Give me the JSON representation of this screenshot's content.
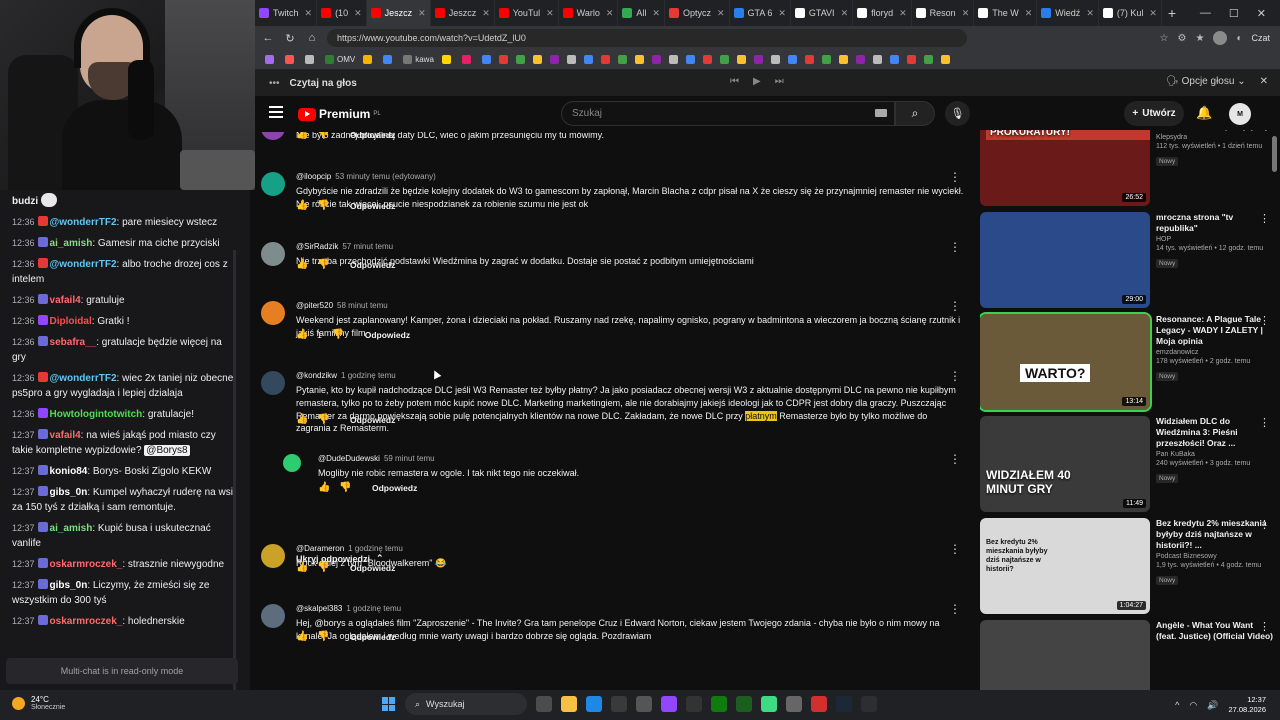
{
  "chat": {
    "top_username": "budzi",
    "messages": [
      {
        "time": "12:36",
        "badge": "yt",
        "user": "@wonderrTF2",
        "color": "#5ec7f5",
        "text": "pare miesiecy wstecz"
      },
      {
        "time": "12:36",
        "badge": "sub",
        "user": "ai_amish",
        "color": "#7ee07e",
        "text": "Gamesir ma ciche przyciski"
      },
      {
        "time": "12:36",
        "badge": "yt",
        "user": "@wonderrTF2",
        "color": "#5ec7f5",
        "text": "albo troche drozej cos z intelem"
      },
      {
        "time": "12:36",
        "badge": "sub",
        "user": "vafail4",
        "color": "#ff6b6b",
        "text": "gratuluje"
      },
      {
        "time": "12:36",
        "badge": "tw",
        "user": "Diploidal",
        "color": "#ff4d4d",
        "text": "Gratki !"
      },
      {
        "time": "12:36",
        "badge": "sub",
        "user": "sebafra__",
        "color": "#ff6b6b",
        "text": "gratulacje będzie więcej na gry"
      },
      {
        "time": "12:36",
        "badge": "yt",
        "user": "@wonderrTF2",
        "color": "#5ec7f5",
        "text": "wiec 2x taniej niz obecne ps5pro a gry wygladaja i lepiej dzialaja"
      },
      {
        "time": "12:36",
        "badge": "tw",
        "user": "Howtologintotwitch",
        "color": "#4cde4c",
        "text": "gratulacje!"
      },
      {
        "time": "12:37",
        "badge": "sub",
        "user": "vafail4",
        "color": "#ff6b6b",
        "text": "na wieś jakąś pod miasto czy takie kompletne wypizdowie?",
        "mention": "@Borys8"
      },
      {
        "time": "12:37",
        "badge": "sub",
        "user": "konio84",
        "color": "#ffffff",
        "text": "Borys- Boski Zigolo KEKW"
      },
      {
        "time": "12:37",
        "badge": "sub",
        "user": "gibs_0n",
        "color": "#ffffff",
        "text": "Kumpel wyhaczył ruderę na wsi za 150 tyś z działką i sam remontuje."
      },
      {
        "time": "12:37",
        "badge": "sub",
        "user": "ai_amish",
        "color": "#7ee07e",
        "text": "Kupić busa i uskutecznać vanlife"
      },
      {
        "time": "12:37",
        "badge": "sub",
        "user": "oskarmroczek_",
        "color": "#ff6b6b",
        "text": "strasznie niewygodne"
      },
      {
        "time": "12:37",
        "badge": "sub",
        "user": "gibs_0n",
        "color": "#ffffff",
        "text": "Liczymy, że zmieści się ze wszystkim do 300 tyś"
      },
      {
        "time": "12:37",
        "badge": "sub",
        "user": "oskarmroczek_",
        "color": "#ff6b6b",
        "text": "holednerskie"
      }
    ],
    "readonly_notice": "Multi-chat is in read-only mode"
  },
  "browser": {
    "tabs": [
      {
        "label": "Twitch",
        "color": "#9147ff"
      },
      {
        "label": "(10",
        "color": "#ff0000"
      },
      {
        "label": "Jeszcz",
        "color": "#ff0000",
        "active": true
      },
      {
        "label": "Jeszcz",
        "color": "#ff0000"
      },
      {
        "label": "YouTul",
        "color": "#ff0000"
      },
      {
        "label": "Warlo",
        "color": "#ff0000"
      },
      {
        "label": "All",
        "color": "#34a853"
      },
      {
        "label": "Optycz",
        "color": "#e53935"
      },
      {
        "label": "GTA 6",
        "color": "#2b7de9"
      },
      {
        "label": "GTAVI",
        "color": "#ffffff"
      },
      {
        "label": "floryd",
        "color": "#ffffff"
      },
      {
        "label": "Reson",
        "color": "#ffffff"
      },
      {
        "label": "The W",
        "color": "#ffffff"
      },
      {
        "label": "Wiedź",
        "color": "#2b7de9"
      },
      {
        "label": "(7) Kul",
        "color": "#ffffff"
      }
    ],
    "url": "https://www.youtube.com/watch?v=UdetdZ_lU0",
    "czat_label": "Czat",
    "bookmarks": [
      {
        "label": "",
        "color": "#a36cf0"
      },
      {
        "label": "",
        "color": "#ff5252"
      },
      {
        "label": "",
        "color": "#bbbbbb"
      },
      {
        "label": "OMV",
        "color": "#2e7d32"
      },
      {
        "label": "",
        "color": "#f4b400"
      },
      {
        "label": "",
        "color": "#4285f4"
      },
      {
        "label": "kawa",
        "color": "#777777"
      },
      {
        "label": "",
        "color": "#ffd600"
      },
      {
        "label": "",
        "color": "#e91e63"
      }
    ],
    "read_aloud": {
      "title": "Czytaj na głos",
      "voice_options": "Opcje głosu"
    }
  },
  "youtube": {
    "brand": "Premium",
    "brand_sup": "PL",
    "search_placeholder": "Szukaj",
    "create_label": "Utwórz",
    "reply_label": "Odpowiedz",
    "hide_replies_label": "Ukryj odpowiedzi",
    "comments": [
      {
        "author": "@jazon9",
        "time": "26 minut temu",
        "avatar": "#8e44ad",
        "text": "Nie było żadnej oficjalnej daty DLC, wiec o jakim przesunięciu my tu mówimy.",
        "likes": ""
      },
      {
        "author": "@iloopcip",
        "time": "53 minuty temu (edytowany)",
        "avatar": "#16a085",
        "text": "Gdybyście nie zdradzili że będzie kolejny dodatek do W3 to gamescom by zapłonął, Marcin Blacha z cdpr pisał na X że cieszy się że przynajmniej remaster nie wyciekł. Nie róbcie tak więcej, psucie niespodzianek za robienie szumu nie jest ok",
        "likes": ""
      },
      {
        "author": "@SirRadzik",
        "time": "57 minut temu",
        "avatar": "#7f8c8d",
        "text": "Nie trzeba przechodzić podstawki Wiedźmina by zagrać w dodatku. Dostaje sie postać z podbitym umiejętnościami",
        "likes": ""
      },
      {
        "author": "@piter520",
        "time": "58 minut temu",
        "avatar": "#e67e22",
        "text": "Weekend jest zaplanowany! Kamper, żona i dzieciaki na pokład. Ruszamy nad rzekę, napalimy ognisko, pograny w badmintona a wieczorem ja boczną ścianę rzutnik i jakiś familijny film",
        "likes": "1"
      },
      {
        "author": "@kondzikw",
        "time": "1 godzinę temu",
        "avatar": "#34495e",
        "text_before": "Pytanie, kto by kupił nadchodzące DLC jeśli W3 Remaster też byłby płatny? Ja jako posiadacz obecnej wersji W3 z aktualnie dostępnymi DLC na pewno nie kupiłbym remastera, tylko po to żeby potem móc kupić nowe DLC. Marketing marketingiem, ale nie dorabiajmy jakiejś ideologi jak to CDPR jest dobry dla graczy. Puszczając Remaster za darmo powiększają sobie pulę potencjalnych klientów na nowe DLC. Zakładam, że nowe DLC przy ",
        "highlight": "płatnym",
        "text_after": " Remasterze było by tylko możliwe do zagrania z Remasterm.",
        "likes": ""
      },
      {
        "author": "@DudeDudewski",
        "time": "59 minut temu",
        "avatar": "#2ecc71",
        "text": "Mogliby nie robic remastera w ogole. I tak nikt tego nie oczekiwał.",
        "likes": ""
      },
      {
        "author": "@Darameron",
        "time": "1 godzinę temu",
        "avatar": "#c9a227",
        "text": "Rock dalej z tym \"Bloodwalkerem\" 😂",
        "likes": ""
      },
      {
        "author": "@skalpel383",
        "time": "1 godzinę temu",
        "avatar": "#5d6d7e",
        "text": "Hej, @borys a oglądałeś film \"Zaproszenie\" - The Invite? Gra tam penelope Cruz i Edward Norton, ciekaw jestem Twojego zdania - chyba nie było o nim mowy na kanale. Ja oglądałem i według mnie warty uwagi i bardzo dobrze się ogląda. Pozdrawiam",
        "likes": ""
      }
    ],
    "sidebar": [
      {
        "title": "Ta Pisarka Pozywa KAŻDEGO Kto Ją Skrytykuje",
        "channel": "Klepsydra",
        "views": "112 tys.",
        "age": "1 dzień temu",
        "badge": "Nowy",
        "duration": "26:52",
        "caption": "PISMO TRAFIA DO PROKURATURY!",
        "bg": "#6b1a1a"
      },
      {
        "title": "mroczna strona \"tv republika\"",
        "channel": "HOP",
        "views": "14 tys.",
        "age": "12 godz. temu",
        "badge": "Nowy",
        "duration": "29:00",
        "caption": "",
        "bg": "#2b4a8a"
      },
      {
        "title": "Resonance: A Plague Tale Legacy - WADY I ZALETY | Moja opinia",
        "channel": "emzdanowicz",
        "views": "178",
        "age": "2 godz. temu",
        "badge": "Nowy",
        "duration": "13:14",
        "caption": "WARTO?",
        "bg": "#6a5a3a"
      },
      {
        "title": "Widziałem DLC do Wiedźmina 3: Pieśni przeszłości! Oraz ...",
        "channel": "Pan KuBaka",
        "views": "240",
        "age": "3 godz. temu",
        "badge": "Nowy",
        "duration": "11:49",
        "caption": "WIDZIAŁEM 40 MINUT GRY",
        "bg": "#3a3a3a"
      },
      {
        "title": "Bez kredytu 2% mieszkania byłyby dziś najtańsze w historii?! ...",
        "channel": "Podcast Biznesowy",
        "views": "1,9 tys.",
        "age": "4 godz. temu",
        "badge": "Nowy",
        "duration": "1:04:27",
        "caption": "Bez kredytu 2% mieszkania byłyby dziś najtańsze w historii?",
        "bg": "#d9d9d9"
      },
      {
        "title": "Angèle - What You Want (feat. Justice) (Official Video)",
        "channel": "",
        "views": "",
        "age": "",
        "badge": "",
        "duration": "",
        "caption": "",
        "bg": "#444444"
      }
    ]
  },
  "taskbar": {
    "temp": "24°C",
    "weather": "Słonecznie",
    "search": "Wyszukaj",
    "time": "12:37",
    "date": "27.08.2026"
  }
}
